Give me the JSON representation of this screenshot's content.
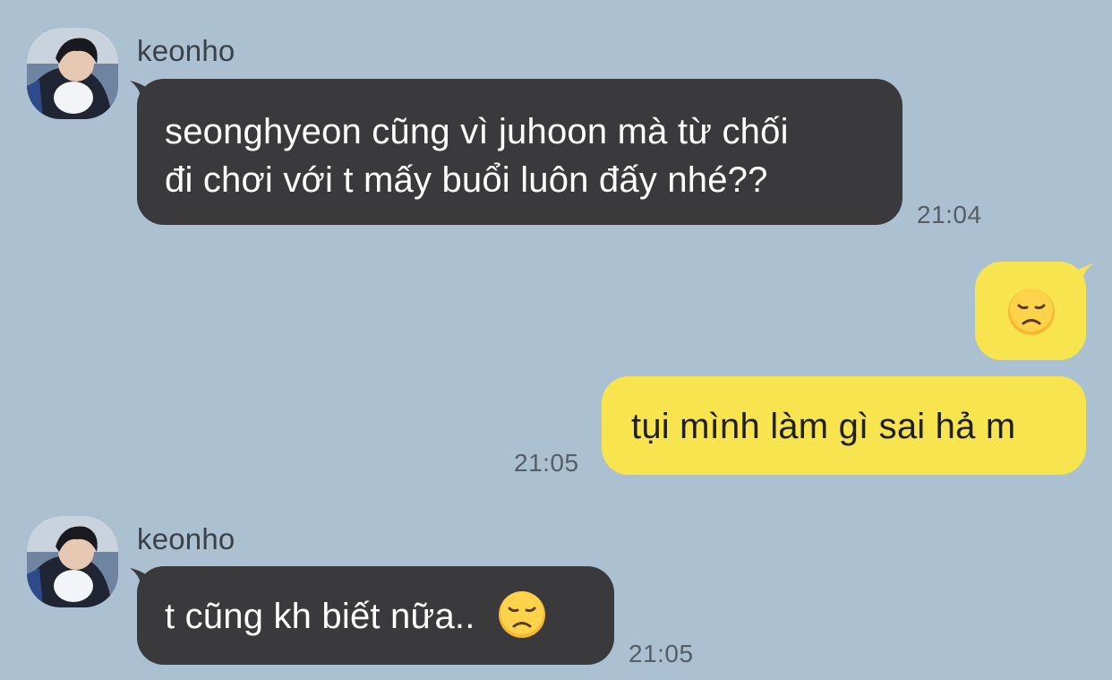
{
  "messages": [
    {
      "sender": "keonho",
      "avatar_icon": "profile-photo",
      "lines": [
        "seonghyeon cũng vì juhoon mà từ chối",
        "đi chơi với t mấy buổi luôn đấy nhé??"
      ],
      "time": "21:04"
    },
    {
      "outgoing": true,
      "emoji": "disappointed-face-emoji"
    },
    {
      "outgoing": true,
      "text": "tụi mình làm gì sai hả m",
      "time": "21:05"
    },
    {
      "sender": "keonho",
      "avatar_icon": "profile-photo",
      "text": "t cũng kh biết nữa..",
      "emoji": "disappointed-face-emoji",
      "time": "21:05"
    }
  ],
  "colors": {
    "background": "#abc1d1",
    "incoming_bubble": "#3a3a3c",
    "outgoing_bubble": "#f8e44f"
  }
}
